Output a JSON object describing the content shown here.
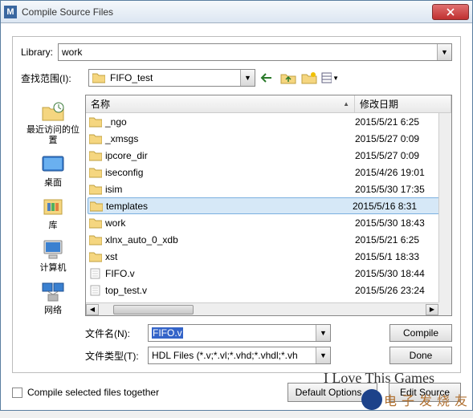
{
  "title": "Compile Source Files",
  "library": {
    "label": "Library:",
    "value": "work"
  },
  "lookin": {
    "label": "查找范围(I):",
    "value": "FIFO_test"
  },
  "columns": {
    "name": "名称",
    "date": "修改日期"
  },
  "files": [
    {
      "name": "_ngo",
      "date": "2015/5/21 6:25",
      "type": "folder"
    },
    {
      "name": "_xmsgs",
      "date": "2015/5/27 0:09",
      "type": "folder"
    },
    {
      "name": "ipcore_dir",
      "date": "2015/5/27 0:09",
      "type": "folder"
    },
    {
      "name": "iseconfig",
      "date": "2015/4/26 19:01",
      "type": "folder"
    },
    {
      "name": "isim",
      "date": "2015/5/30 17:35",
      "type": "folder"
    },
    {
      "name": "templates",
      "date": "2015/5/16 8:31",
      "type": "folder",
      "selected": true
    },
    {
      "name": "work",
      "date": "2015/5/30 18:43",
      "type": "folder"
    },
    {
      "name": "xlnx_auto_0_xdb",
      "date": "2015/5/21 6:25",
      "type": "folder"
    },
    {
      "name": "xst",
      "date": "2015/5/1 18:33",
      "type": "folder"
    },
    {
      "name": "FIFO.v",
      "date": "2015/5/30 18:44",
      "type": "file"
    },
    {
      "name": "top_test.v",
      "date": "2015/5/26 23:24",
      "type": "file"
    }
  ],
  "places": {
    "recent": "最近访问的位\n置",
    "desktop": "桌面",
    "libraries": "库",
    "computer": "计算机",
    "network": "网络"
  },
  "filename": {
    "label": "文件名(N):",
    "value": "FIFO.v"
  },
  "filetype": {
    "label": "文件类型(T):",
    "value": "HDL Files (*.v;*.vl;*.vhd;*.vhdl;*.vh"
  },
  "buttons": {
    "compile": "Compile",
    "done": "Done",
    "default_options": "Default Options...",
    "edit_source": "Edit Source"
  },
  "checkbox_label": "Compile selected files together",
  "cursive": "I Love This Games",
  "overlay": "电子发烧友"
}
